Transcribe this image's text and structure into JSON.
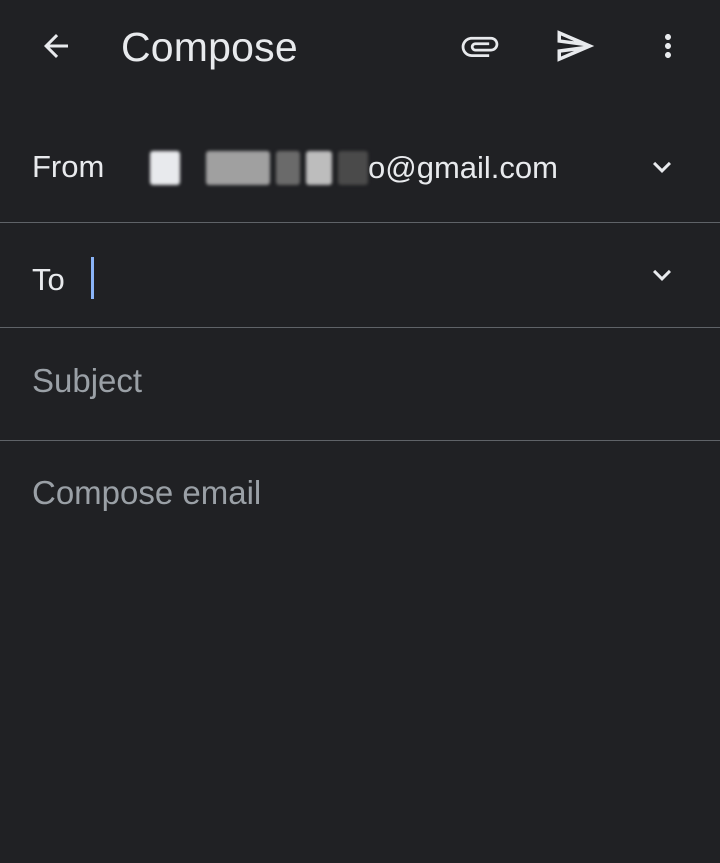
{
  "topbar": {
    "title": "Compose",
    "back_icon": "arrow-back-icon",
    "attach_icon": "paperclip-icon",
    "send_icon": "send-icon",
    "more_icon": "more-vert-icon"
  },
  "from": {
    "label": "From",
    "value_visible_suffix": "o@gmail.com",
    "value_redacted": true,
    "expand_icon": "chevron-down-icon"
  },
  "to": {
    "label": "To",
    "value": "",
    "expand_icon": "chevron-down-icon"
  },
  "subject": {
    "placeholder": "Subject",
    "value": ""
  },
  "body": {
    "placeholder": "Compose email",
    "value": ""
  },
  "colors": {
    "background": "#202124",
    "text": "#e8eaed",
    "placeholder": "#9aa0a6",
    "divider": "#5f6368",
    "caret": "#8ab4f8"
  }
}
